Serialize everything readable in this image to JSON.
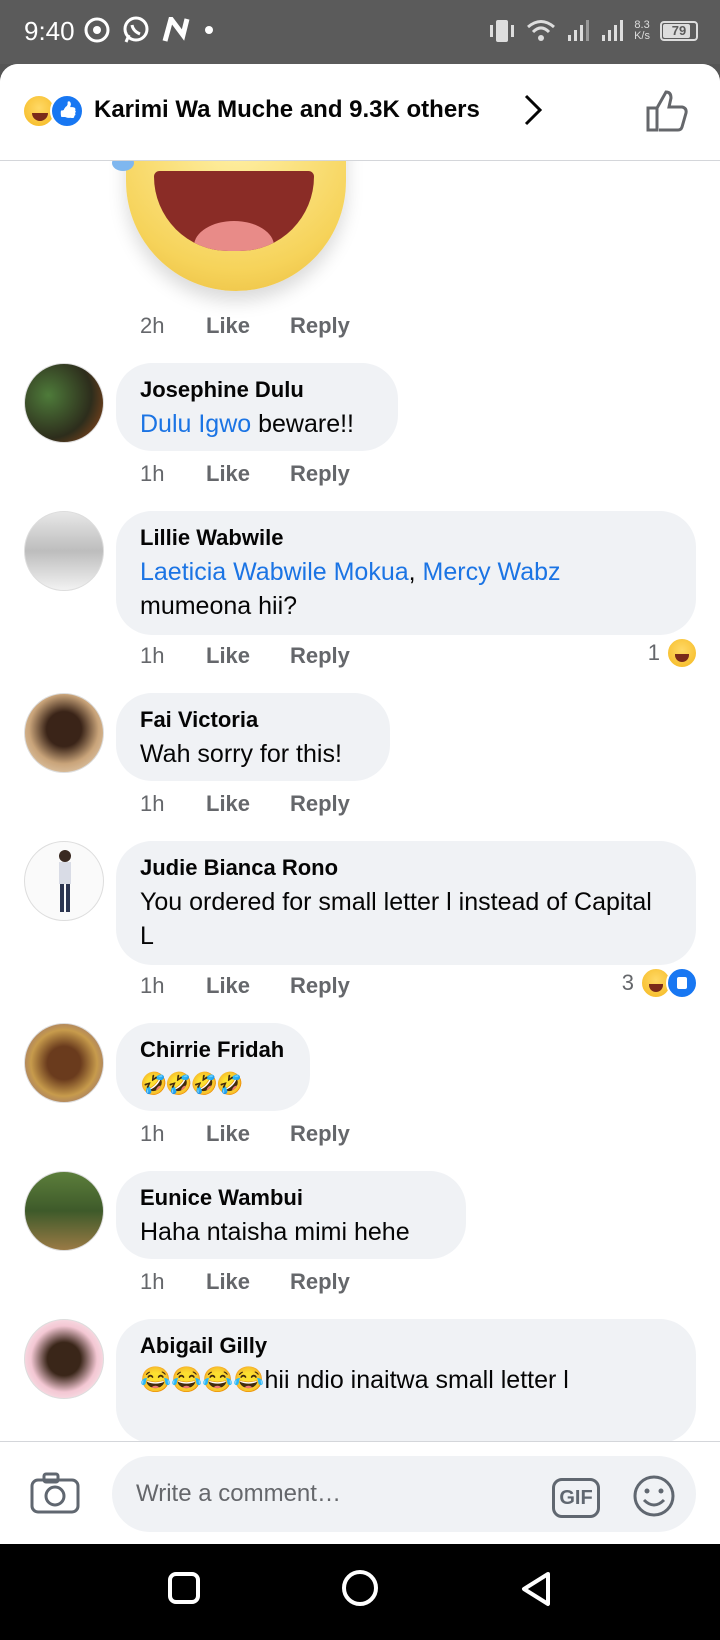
{
  "status_bar": {
    "time": "9:40",
    "net_speed_value": "8.3",
    "net_speed_unit": "K/s",
    "battery": "79",
    "battery_level": 0.79,
    "icons_left": [
      "chrome-icon",
      "whatsapp-icon",
      "n-app-icon",
      "dot-icon"
    ],
    "icons_right": [
      "vibrate-icon",
      "wifi-icon",
      "signal-icon",
      "signal-icon",
      "battery-icon"
    ]
  },
  "header": {
    "title": "Karimi Wa Muche and 9.3K others",
    "reaction_icons": [
      "haha-icon",
      "like-icon"
    ]
  },
  "first_meta": {
    "time": "2h",
    "like": "Like",
    "reply": "Reply"
  },
  "comments": [
    {
      "author": "Josephine Dulu",
      "mentions": [
        "Dulu Igwo"
      ],
      "text_after": " beware!!",
      "time": "1h",
      "like": "Like",
      "reply": "Reply"
    },
    {
      "author": "Lillie Wabwile",
      "mentions": [
        "Laeticia Wabwile Mokua",
        "Mercy Wabz"
      ],
      "separator": ", ",
      "text_after": "mumeona hii?",
      "time": "1h",
      "like": "Like",
      "reply": "Reply",
      "reaction_count": "1"
    },
    {
      "author": "Fai Victoria",
      "text": "Wah sorry for this!",
      "time": "1h",
      "like": "Like",
      "reply": "Reply"
    },
    {
      "author": "Judie Bianca Rono",
      "text": "You ordered for small letter l instead of Capital L",
      "time": "1h",
      "like": "Like",
      "reply": "Reply",
      "reaction_count": "3"
    },
    {
      "author": "Chirrie Fridah",
      "text": "🤣🤣🤣🤣",
      "time": "1h",
      "like": "Like",
      "reply": "Reply"
    },
    {
      "author": "Eunice Wambui",
      "text": "Haha ntaisha mimi hehe",
      "time": "1h",
      "like": "Like",
      "reply": "Reply"
    },
    {
      "author": "Abigail Gilly",
      "text": "😂😂😂😂hii ndio inaitwa small letter l"
    }
  ],
  "composer": {
    "placeholder": "Write a comment…",
    "gif": "GIF"
  },
  "colors": {
    "mention": "#1b74e4",
    "like_blue": "#1877f2",
    "bubble": "#f0f2f5",
    "secondary_text": "#65676b"
  }
}
